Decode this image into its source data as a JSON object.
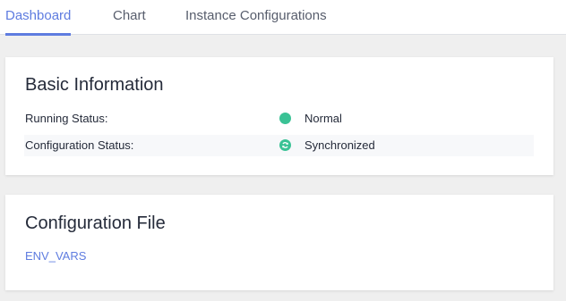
{
  "tabs": [
    {
      "label": "Dashboard",
      "active": true
    },
    {
      "label": "Chart",
      "active": false
    },
    {
      "label": "Instance Configurations",
      "active": false
    }
  ],
  "basic_info": {
    "title": "Basic Information",
    "rows": [
      {
        "label": "Running Status:",
        "icon": "status-dot-icon",
        "value": "Normal"
      },
      {
        "label": "Configuration Status:",
        "icon": "sync-icon",
        "value": "Synchronized"
      }
    ]
  },
  "config_file": {
    "title": "Configuration File",
    "link": "ENV_VARS"
  },
  "colors": {
    "accent": "#5e7ce0",
    "success": "#3ac295"
  }
}
